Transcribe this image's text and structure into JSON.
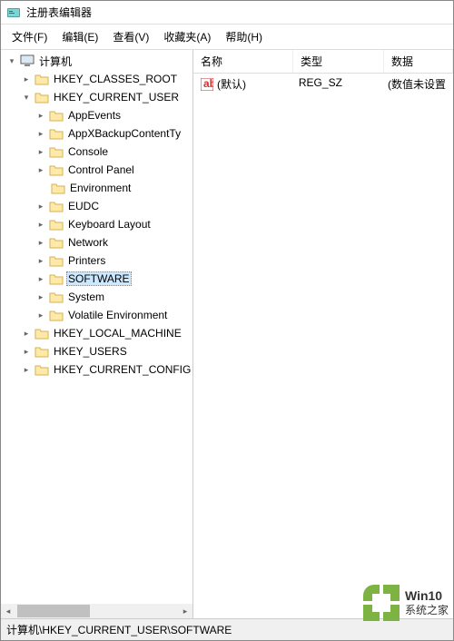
{
  "window": {
    "title": "注册表编辑器"
  },
  "menu": {
    "file": "文件(F)",
    "edit": "编辑(E)",
    "view": "查看(V)",
    "favorites": "收藏夹(A)",
    "help": "帮助(H)"
  },
  "tree": {
    "root": "计算机",
    "hives": {
      "classes_root": "HKEY_CLASSES_ROOT",
      "current_user": "HKEY_CURRENT_USER",
      "local_machine": "HKEY_LOCAL_MACHINE",
      "users": "HKEY_USERS",
      "current_config": "HKEY_CURRENT_CONFIG"
    },
    "cu_children": {
      "appevents": "AppEvents",
      "appxbackup": "AppXBackupContentTy",
      "console": "Console",
      "controlpanel": "Control Panel",
      "environment": "Environment",
      "eudc": "EUDC",
      "keyboard": "Keyboard Layout",
      "network": "Network",
      "printers": "Printers",
      "software": "SOFTWARE",
      "system": "System",
      "volatile": "Volatile Environment"
    }
  },
  "list": {
    "headers": {
      "name": "名称",
      "type": "类型",
      "data": "数据"
    },
    "rows": [
      {
        "name": "(默认)",
        "type": "REG_SZ",
        "data": "(数值未设置"
      }
    ]
  },
  "statusbar": {
    "path": "计算机\\HKEY_CURRENT_USER\\SOFTWARE"
  },
  "watermark": {
    "line1": "Win10",
    "line2": "系统之家"
  }
}
